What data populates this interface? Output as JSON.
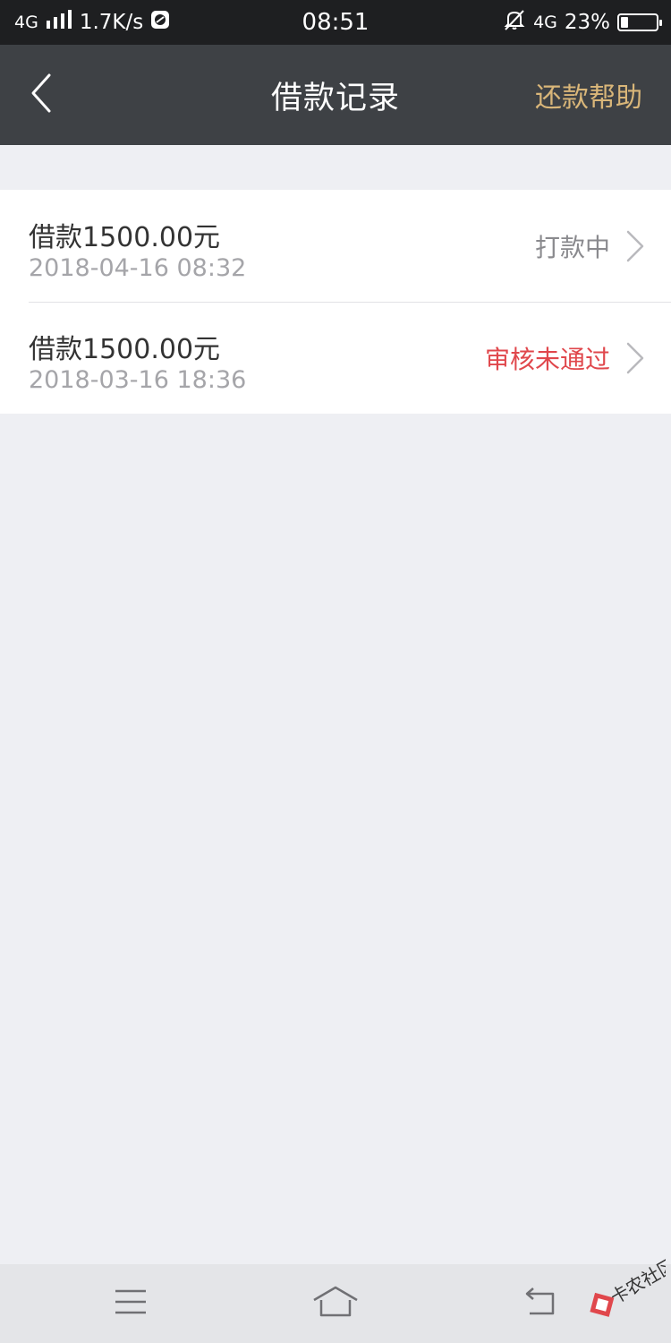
{
  "status_bar": {
    "network_left": "4G",
    "speed": "1.7K/s",
    "time": "08:51",
    "network_right": "4G",
    "battery": "23%"
  },
  "header": {
    "title": "借款记录",
    "action_label": "还款帮助",
    "action_color": "#d9b679"
  },
  "records": [
    {
      "amount": "借款1500.00元",
      "date": "2018-04-16 08:32",
      "status": "打款中",
      "status_color": "#8a8a8e"
    },
    {
      "amount": "借款1500.00元",
      "date": "2018-03-16 18:36",
      "status": "审核未通过",
      "status_color": "#e0474c"
    }
  ],
  "watermark": {
    "text": "卡农社区"
  },
  "icons": {
    "back": "chevron-left-icon",
    "row_arrow": "chevron-right-icon",
    "menu": "menu-icon",
    "home": "home-icon",
    "return": "return-icon"
  }
}
